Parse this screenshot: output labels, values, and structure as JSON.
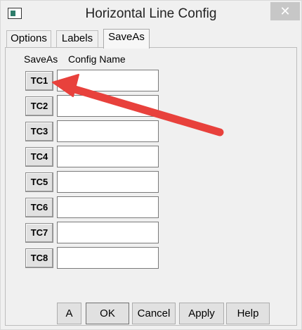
{
  "window": {
    "title": "Horizontal Line Config",
    "close_glyph": "✕"
  },
  "tabs": [
    {
      "label": "Options",
      "active": false
    },
    {
      "label": "Labels",
      "active": false
    },
    {
      "label": "SaveAs",
      "active": true
    }
  ],
  "saveas": {
    "col_saveas": "SaveAs",
    "col_config_name": "Config Name",
    "rows": [
      {
        "button": "TC1",
        "value": ""
      },
      {
        "button": "TC2",
        "value": ""
      },
      {
        "button": "TC3",
        "value": ""
      },
      {
        "button": "TC4",
        "value": ""
      },
      {
        "button": "TC5",
        "value": ""
      },
      {
        "button": "TC6",
        "value": ""
      },
      {
        "button": "TC7",
        "value": ""
      },
      {
        "button": "TC8",
        "value": ""
      }
    ]
  },
  "buttons": {
    "a": "A",
    "ok": "OK",
    "cancel": "Cancel",
    "apply": "Apply",
    "help": "Help"
  },
  "annotation": {
    "color": "#e8413c"
  }
}
